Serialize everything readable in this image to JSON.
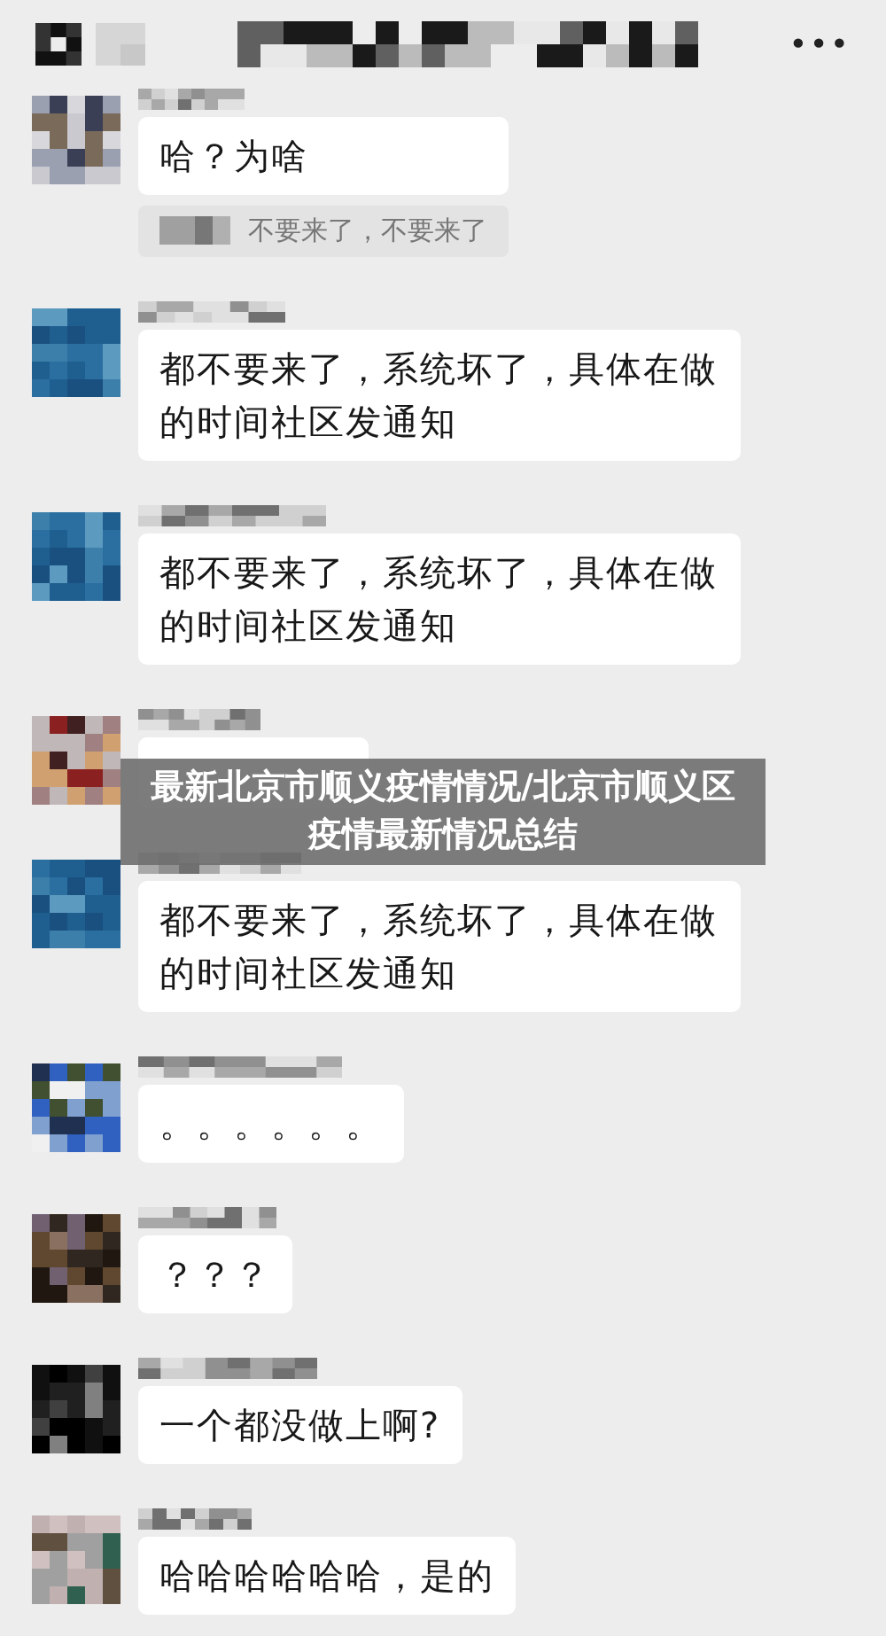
{
  "header": {
    "more_icon": "•••"
  },
  "messages": [
    {
      "kind": "text",
      "text": "哈？为啥",
      "quote": "不要来了，不要来了"
    },
    {
      "kind": "text",
      "text": "都不要来了，系统坏了，具体在做的时间社区发通知"
    },
    {
      "kind": "text",
      "text": "都不要来了，系统坏了，具体在做的时间社区发通知"
    },
    {
      "kind": "covered"
    },
    {
      "kind": "text",
      "text": "都不要来了，系统坏了，具体在做的时间社区发通知"
    },
    {
      "kind": "text",
      "text": "。。。。。。"
    },
    {
      "kind": "text",
      "text": "？？？"
    },
    {
      "kind": "text",
      "text": "一个都没做上啊?"
    },
    {
      "kind": "text",
      "text": "哈哈哈哈哈哈，是的"
    }
  ],
  "overlay_caption": "最新北京市顺义疫情情况/北京市顺义区疫情最新情况总结"
}
